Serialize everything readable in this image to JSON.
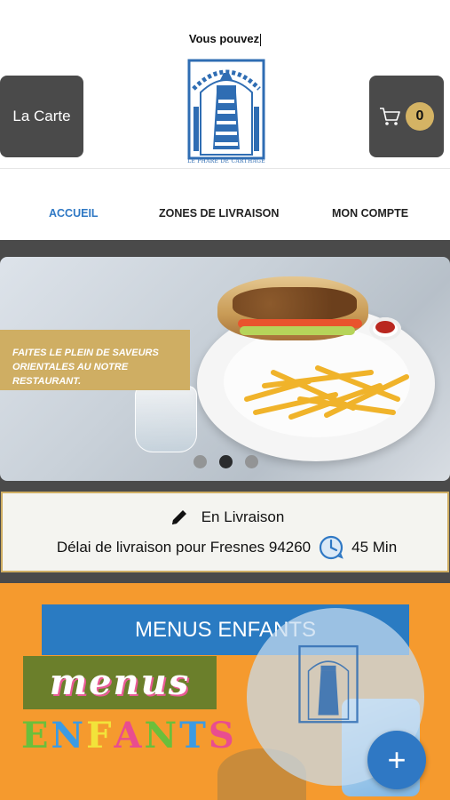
{
  "header": {
    "notice_text": "Vous pouvez",
    "carte_label": "La Carte",
    "cart_count": "0",
    "logo_caption": "LE PHARE DE CARTHAGE"
  },
  "nav": {
    "tabs": [
      {
        "label": "ACCUEIL",
        "active": true
      },
      {
        "label": "ZONES DE LIVRAISON",
        "active": false
      },
      {
        "label": "MON COMPTE",
        "active": false
      }
    ]
  },
  "banner": {
    "promo_line1": "FAITES LE PLEIN DE SAVEURS",
    "promo_line2": "ORIENTALES AU NOTRE RESTAURANT.",
    "slide_count": 3,
    "active_slide": 2
  },
  "delivery": {
    "mode_label": "En Livraison",
    "delay_text": "Délai de livraison pour Fresnes 94260",
    "delay_value": "45 Min"
  },
  "category": {
    "title": "MENUS ENFANTS",
    "art_word1": "menus",
    "art_word2": "ENFANTS"
  },
  "fab": {
    "label": "+"
  },
  "colors": {
    "accent_blue": "#2f78c4",
    "gold": "#cfae63",
    "dark_button": "#4a4a4a",
    "category_bg": "#f59a2e"
  },
  "icons": {
    "cart": "shopping-cart-icon",
    "edit": "pencil-icon",
    "clock": "clock-icon",
    "add": "plus-icon"
  }
}
